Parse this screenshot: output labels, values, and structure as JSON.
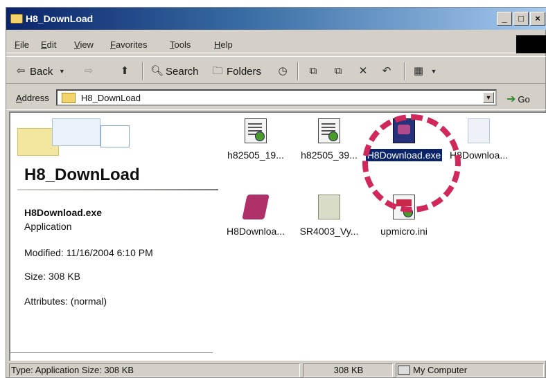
{
  "window": {
    "title": "H8_DownLoad",
    "controls": [
      "_",
      "□",
      "×"
    ]
  },
  "menubar": {
    "items": [
      "File",
      "Edit",
      "View",
      "Favorites",
      "Tools",
      "Help"
    ]
  },
  "toolbar": {
    "back_label": "Back",
    "search_label": "Search",
    "folders_label": "Folders"
  },
  "address": {
    "label": "Address",
    "value": "H8_DownLoad",
    "go_label": "Go"
  },
  "details": {
    "folder_title": "H8_DownLoad",
    "selected_name": "H8Download.exe",
    "selected_type": "Application",
    "modified": "Modified: 11/16/2004 6:10 PM",
    "size": "Size: 308 KB",
    "attributes": "Attributes: (normal)"
  },
  "files": [
    {
      "label": "h82505_19...",
      "icon": "document-icon"
    },
    {
      "label": "h82505_39...",
      "icon": "document-icon"
    },
    {
      "label": "H8Download.exe",
      "icon": "application-icon",
      "selected": true
    },
    {
      "label": "H8Downloa...",
      "icon": "file-icon"
    },
    {
      "label": "H8Downloa...",
      "icon": "help-book-icon"
    },
    {
      "label": "SR4003_Vy...",
      "icon": "file-icon"
    },
    {
      "label": "upmicro.ini",
      "icon": "ini-file-icon"
    }
  ],
  "statusbar": {
    "type_text": "Type: Application Size: 308 KB",
    "size_text": "308 KB",
    "zone_text": "My Computer"
  },
  "colors": {
    "titlebar": "#0a246a",
    "selection": "#0a246a",
    "highlight_ring": "#d0285a",
    "chrome": "#d4d0c8"
  }
}
